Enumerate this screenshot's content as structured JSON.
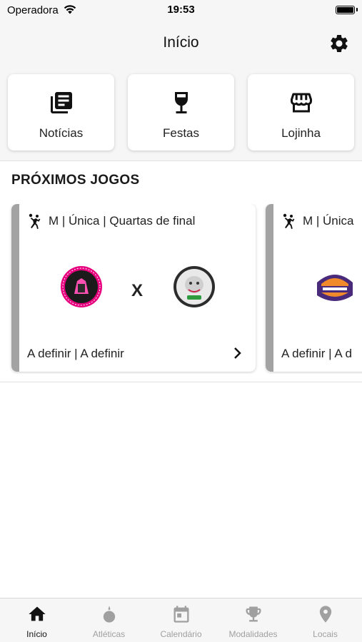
{
  "status_bar": {
    "carrier": "Operadora",
    "time": "19:53"
  },
  "header": {
    "title": "Início",
    "settings_icon": "gear-icon"
  },
  "shortcuts": [
    {
      "label": "Notícias",
      "icon": "newspaper-icon"
    },
    {
      "label": "Festas",
      "icon": "wine-glass-icon"
    },
    {
      "label": "Lojinha",
      "icon": "store-icon"
    }
  ],
  "section_title": "PRÓXIMOS JOGOS",
  "games": [
    {
      "sport_icon": "handball-icon",
      "meta": "M | Única | Quartas de final",
      "vs": "X",
      "footer": "A definir | A definir",
      "team_a_colors": {
        "ring": "#e6007e",
        "fill": "#1b1b1b"
      },
      "team_b_colors": {
        "ring": "#2c2c2c",
        "fill": "#e9e9e9"
      }
    },
    {
      "sport_icon": "handball-icon",
      "meta": "M | Única",
      "footer": "A definir | A d",
      "team_a_colors": {
        "ring": "#4a2a7a",
        "fill": "#f08a2a"
      }
    }
  ],
  "tabs": [
    {
      "label": "Início",
      "icon": "home-icon",
      "active": true
    },
    {
      "label": "Atléticas",
      "icon": "atleticas-icon",
      "active": false
    },
    {
      "label": "Calendário",
      "icon": "calendar-icon",
      "active": false
    },
    {
      "label": "Modalidades",
      "icon": "trophy-icon",
      "active": false
    },
    {
      "label": "Locais",
      "icon": "map-pin-icon",
      "active": false
    }
  ],
  "colors": {
    "accent_bar": "#a3a3a3",
    "active_tab": "#111111",
    "inactive_tab": "#a0a0a0"
  }
}
